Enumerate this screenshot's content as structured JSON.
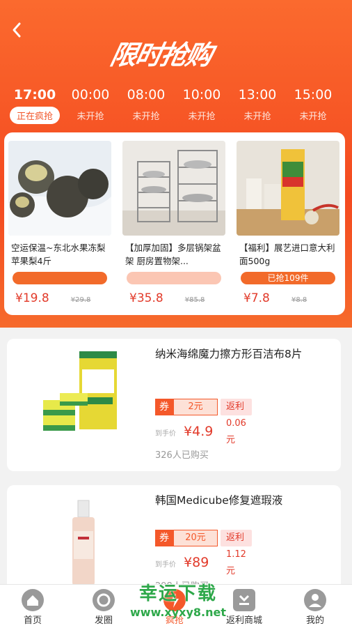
{
  "header": {
    "logo_text": "限时抢购",
    "timeslots": [
      {
        "time": "17:00",
        "status": "正在疯抢",
        "active": true
      },
      {
        "time": "00:00",
        "status": "未开抢",
        "active": false
      },
      {
        "time": "08:00",
        "status": "未开抢",
        "active": false
      },
      {
        "time": "10:00",
        "status": "未开抢",
        "active": false
      },
      {
        "time": "13:00",
        "status": "未开抢",
        "active": false
      },
      {
        "time": "15:00",
        "status": "未开抢",
        "active": false
      }
    ]
  },
  "flash_items": [
    {
      "title": "空运保温~东北水果冻梨苹果梨4斤",
      "bar_text": "",
      "price": "¥19.8",
      "original": "¥29.8"
    },
    {
      "title": "【加厚加固】多层锅架盆架 厨房置物架...",
      "bar_text": "",
      "price": "¥35.8",
      "original": "¥85.8"
    },
    {
      "title": "【福利】展艺进口意大利面500g",
      "bar_text": "已抢109件",
      "price": "¥7.8",
      "original": "¥8.8"
    }
  ],
  "products": [
    {
      "title": "纳米海绵魔力擦方形百洁布8片",
      "coupon_label": "券",
      "coupon_value": "2元",
      "rebate": "返利0.06元",
      "price_label": "到手价",
      "price": "¥4.9",
      "sold": "326人已购买"
    },
    {
      "title": "韩国Medicube修复遮瑕液",
      "coupon_label": "券",
      "coupon_value": "20元",
      "rebate": "返利1.12元",
      "price_label": "到手价",
      "price": "¥89",
      "sold": "298人已购买"
    }
  ],
  "nav": [
    {
      "label": "首页",
      "icon": "home-icon"
    },
    {
      "label": "发圈",
      "icon": "circle-icon"
    },
    {
      "label": "疯抢",
      "icon": "flash-icon"
    },
    {
      "label": "返利商城",
      "icon": "mall-icon"
    },
    {
      "label": "我的",
      "icon": "user-icon"
    }
  ],
  "watermark": {
    "line1": "幸运下载",
    "line2": "www.xyxy8.net"
  }
}
